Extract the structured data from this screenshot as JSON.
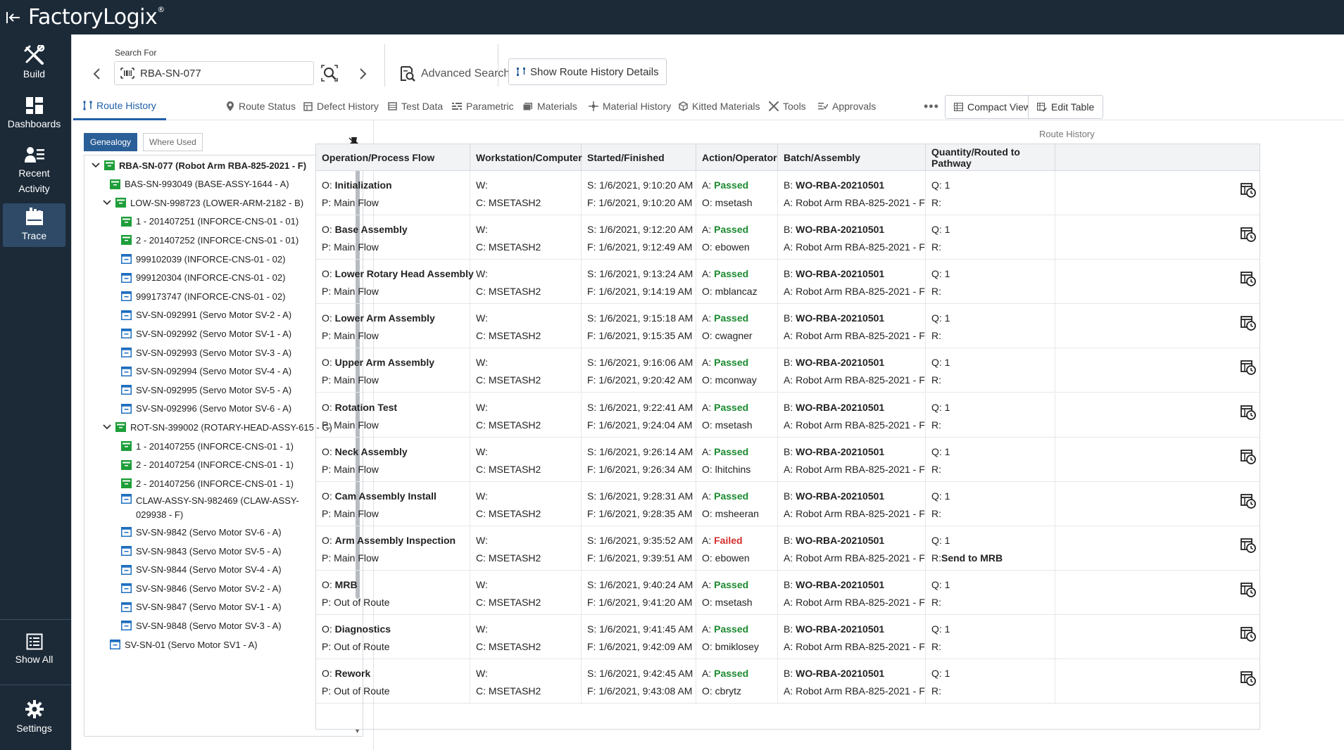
{
  "app": {
    "logo": "FactoryLogix",
    "logo_mark": "®"
  },
  "nav": {
    "items": [
      {
        "label": "Build",
        "icon": "tools-icon"
      },
      {
        "label": "Dashboards",
        "icon": "dashboard-icon"
      },
      {
        "label": "Recent Activity",
        "icon": "recent-activity-icon"
      },
      {
        "label": "Trace",
        "icon": "trace-icon",
        "active": true
      }
    ],
    "bottom": [
      {
        "label": "Show All",
        "icon": "list-icon"
      },
      {
        "label": "Settings",
        "icon": "gear-icon"
      }
    ]
  },
  "search": {
    "label": "Search For",
    "value": "RBA-SN-077",
    "advanced": "Advanced Search",
    "show_details": "Show Route History Details"
  },
  "tabs": [
    {
      "label": "Route History",
      "icon": "route-icon",
      "active": true
    },
    {
      "label": "Route Status",
      "icon": "pin-icon"
    },
    {
      "label": "Defect History",
      "icon": "defect-icon"
    },
    {
      "label": "Test Data",
      "icon": "test-data-icon"
    },
    {
      "label": "Parametric",
      "icon": "parametric-icon"
    },
    {
      "label": "Materials",
      "icon": "materials-icon"
    },
    {
      "label": "Material History",
      "icon": "material-history-icon"
    },
    {
      "label": "Kitted Materials",
      "icon": "kitted-icon"
    },
    {
      "label": "Tools",
      "icon": "tools-icon"
    },
    {
      "label": "Approvals",
      "icon": "approvals-icon"
    }
  ],
  "tab_more": "•••",
  "view_buttons": {
    "compact": "Compact View",
    "edit": "Edit Table"
  },
  "tree": {
    "genealogy": "Genealogy",
    "where_used": "Where Used",
    "nodes": [
      {
        "label": "RBA-SN-077 (Robot Arm RBA-825-2021 - F)",
        "level": 0,
        "expander": "open",
        "icon": "green",
        "bold": true
      },
      {
        "label": "BAS-SN-993049 (BASE-ASSY-1644 - A)",
        "level": 1,
        "expander": "none",
        "icon": "green"
      },
      {
        "label": "LOW-SN-998723 (LOWER-ARM-2182 - B)",
        "level": 1,
        "expander": "open",
        "icon": "green"
      },
      {
        "label": "1 - 201407251 (INFORCE-CNS-01 - 01)",
        "level": 2,
        "expander": "none",
        "icon": "green"
      },
      {
        "label": "2 - 201407252 (INFORCE-CNS-01 - 01)",
        "level": 2,
        "expander": "none",
        "icon": "green"
      },
      {
        "label": "999102039 (INFORCE-CNS-01 - 02)",
        "level": 2,
        "expander": "none",
        "icon": "blue"
      },
      {
        "label": "999120304 (INFORCE-CNS-01 - 02)",
        "level": 2,
        "expander": "none",
        "icon": "blue"
      },
      {
        "label": "999173747 (INFORCE-CNS-01 - 02)",
        "level": 2,
        "expander": "none",
        "icon": "blue"
      },
      {
        "label": "SV-SN-092991 (Servo Motor SV-2 - A)",
        "level": 2,
        "expander": "none",
        "icon": "blue"
      },
      {
        "label": "SV-SN-092992 (Servo Motor SV-1 - A)",
        "level": 2,
        "expander": "none",
        "icon": "blue"
      },
      {
        "label": "SV-SN-092993 (Servo Motor SV-3 - A)",
        "level": 2,
        "expander": "none",
        "icon": "blue"
      },
      {
        "label": "SV-SN-092994 (Servo Motor SV-4 - A)",
        "level": 2,
        "expander": "none",
        "icon": "blue"
      },
      {
        "label": "SV-SN-092995 (Servo Motor SV-5 - A)",
        "level": 2,
        "expander": "none",
        "icon": "blue"
      },
      {
        "label": "SV-SN-092996 (Servo Motor SV-6 - A)",
        "level": 2,
        "expander": "none",
        "icon": "blue"
      },
      {
        "label": "ROT-SN-399002 (ROTARY-HEAD-ASSY-615 - G)",
        "level": 1,
        "expander": "open",
        "icon": "green"
      },
      {
        "label": "1 - 201407255 (INFORCE-CNS-01 - 1)",
        "level": 2,
        "expander": "none",
        "icon": "green"
      },
      {
        "label": "2 - 201407254 (INFORCE-CNS-01 - 1)",
        "level": 2,
        "expander": "none",
        "icon": "green"
      },
      {
        "label": "2 - 201407256 (INFORCE-CNS-01 - 1)",
        "level": 2,
        "expander": "none",
        "icon": "green"
      },
      {
        "label": "CLAW-ASSY-SN-982469 (CLAW-ASSY-029938 - F)",
        "level": 2,
        "expander": "none",
        "icon": "blue",
        "wrap": true
      },
      {
        "label": "SV-SN-9842 (Servo Motor SV-6 - A)",
        "level": 2,
        "expander": "none",
        "icon": "blue"
      },
      {
        "label": "SV-SN-9843 (Servo Motor SV-5 - A)",
        "level": 2,
        "expander": "none",
        "icon": "blue"
      },
      {
        "label": "SV-SN-9844 (Servo Motor SV-4 - A)",
        "level": 2,
        "expander": "none",
        "icon": "blue"
      },
      {
        "label": "SV-SN-9846 (Servo Motor SV-2 - A)",
        "level": 2,
        "expander": "none",
        "icon": "blue"
      },
      {
        "label": "SV-SN-9847 (Servo Motor SV-1 - A)",
        "level": 2,
        "expander": "none",
        "icon": "blue"
      },
      {
        "label": "SV-SN-9848 (Servo Motor SV-3 - A)",
        "level": 2,
        "expander": "none",
        "icon": "blue"
      },
      {
        "label": "SV-SN-01 (Servo Motor SV1 - A)",
        "level": 1,
        "expander": "none",
        "icon": "blue"
      }
    ]
  },
  "table": {
    "title": "Route History",
    "headers": [
      "Operation/Process Flow",
      "Workstation/Computer",
      "Started/Finished",
      "Action/Operator",
      "Batch/Assembly",
      "Quantity/Routed to Pathway"
    ],
    "prefix": {
      "op": "O: ",
      "pf": "P: ",
      "ws": "W:",
      "comp": "C: ",
      "start": "S: ",
      "finish": "F: ",
      "action": "A: ",
      "operator": "O: ",
      "batch": "B: ",
      "assembly": "A: ",
      "qty": "Q: ",
      "routed": "R:"
    },
    "rows": [
      {
        "op": "Initialization",
        "flow": "Main Flow",
        "ws": "",
        "computer": "MSETASH2",
        "start": "1/6/2021, 9:10:20 AM",
        "finish": "1/6/2021, 9:10:20 AM",
        "action": "Passed",
        "operator": "msetash",
        "batch": "WO-RBA-20210501",
        "assembly": "Robot Arm RBA-825-2021 - F",
        "qty": "1",
        "routed": ""
      },
      {
        "op": "Base Assembly",
        "flow": "Main Flow",
        "ws": "",
        "computer": "MSETASH2",
        "start": "1/6/2021, 9:12:20 AM",
        "finish": "1/6/2021, 9:12:49 AM",
        "action": "Passed",
        "operator": "ebowen",
        "batch": "WO-RBA-20210501",
        "assembly": "Robot Arm RBA-825-2021 - F",
        "qty": "1",
        "routed": ""
      },
      {
        "op": "Lower Rotary Head Assembly",
        "flow": "Main Flow",
        "ws": "",
        "computer": "MSETASH2",
        "start": "1/6/2021, 9:13:24 AM",
        "finish": "1/6/2021, 9:14:19 AM",
        "action": "Passed",
        "operator": "mblancaz",
        "batch": "WO-RBA-20210501",
        "assembly": "Robot Arm RBA-825-2021 - F",
        "qty": "1",
        "routed": ""
      },
      {
        "op": "Lower Arm Assembly",
        "flow": "Main Flow",
        "ws": "",
        "computer": "MSETASH2",
        "start": "1/6/2021, 9:15:18 AM",
        "finish": "1/6/2021, 9:15:35 AM",
        "action": "Passed",
        "operator": "cwagner",
        "batch": "WO-RBA-20210501",
        "assembly": "Robot Arm RBA-825-2021 - F",
        "qty": "1",
        "routed": ""
      },
      {
        "op": "Upper Arm Assembly",
        "flow": "Main Flow",
        "ws": "",
        "computer": "MSETASH2",
        "start": "1/6/2021, 9:16:06 AM",
        "finish": "1/6/2021, 9:20:42 AM",
        "action": "Passed",
        "operator": "mconway",
        "batch": "WO-RBA-20210501",
        "assembly": "Robot Arm RBA-825-2021 - F",
        "qty": "1",
        "routed": ""
      },
      {
        "op": "Rotation Test",
        "flow": "Main Flow",
        "ws": "",
        "computer": "MSETASH2",
        "start": "1/6/2021, 9:22:41 AM",
        "finish": "1/6/2021, 9:24:04 AM",
        "action": "Passed",
        "operator": "msetash",
        "batch": "WO-RBA-20210501",
        "assembly": "Robot Arm RBA-825-2021 - F",
        "qty": "1",
        "routed": ""
      },
      {
        "op": "Neck Assembly",
        "flow": "Main Flow",
        "ws": "",
        "computer": "MSETASH2",
        "start": "1/6/2021, 9:26:14 AM",
        "finish": "1/6/2021, 9:26:34 AM",
        "action": "Passed",
        "operator": "lhitchins",
        "batch": "WO-RBA-20210501",
        "assembly": "Robot Arm RBA-825-2021 - F",
        "qty": "1",
        "routed": ""
      },
      {
        "op": "Cam Assembly Install",
        "flow": "Main Flow",
        "ws": "",
        "computer": "MSETASH2",
        "start": "1/6/2021, 9:28:31 AM",
        "finish": "1/6/2021, 9:28:35 AM",
        "action": "Passed",
        "operator": "msheeran",
        "batch": "WO-RBA-20210501",
        "assembly": "Robot Arm RBA-825-2021 - F",
        "qty": "1",
        "routed": ""
      },
      {
        "op": "Arm Assembly Inspection",
        "flow": "Main Flow",
        "ws": "",
        "computer": "MSETASH2",
        "start": "1/6/2021, 9:35:52 AM",
        "finish": "1/6/2021, 9:39:51 AM",
        "action": "Failed",
        "operator": "ebowen",
        "batch": "WO-RBA-20210501",
        "assembly": "Robot Arm RBA-825-2021 - F",
        "qty": "1",
        "routed": "Send to MRB"
      },
      {
        "op": "MRB",
        "flow": "Out of Route",
        "ws": "",
        "computer": "MSETASH2",
        "start": "1/6/2021, 9:40:24 AM",
        "finish": "1/6/2021, 9:41:20 AM",
        "action": "Passed",
        "operator": "msetash",
        "batch": "WO-RBA-20210501",
        "assembly": "Robot Arm RBA-825-2021 - F",
        "qty": "1",
        "routed": ""
      },
      {
        "op": "Diagnostics",
        "flow": "Out of Route",
        "ws": "",
        "computer": "MSETASH2",
        "start": "1/6/2021, 9:41:45 AM",
        "finish": "1/6/2021, 9:42:09 AM",
        "action": "Passed",
        "operator": "bmiklosey",
        "batch": "WO-RBA-20210501",
        "assembly": "Robot Arm RBA-825-2021 - F",
        "qty": "1",
        "routed": ""
      },
      {
        "op": "Rework",
        "flow": "Out of Route",
        "ws": "",
        "computer": "MSETASH2",
        "start": "1/6/2021, 9:42:45 AM",
        "finish": "1/6/2021, 9:43:08 AM",
        "action": "Passed",
        "operator": "cbrytz",
        "batch": "WO-RBA-20210501",
        "assembly": "Robot Arm RBA-825-2021 - F",
        "qty": "1",
        "routed": ""
      }
    ]
  },
  "colors": {
    "nav_bg": "#1c2a38",
    "accent": "#1f5fa8",
    "passed": "#1b8a2f",
    "failed": "#d32f2f",
    "tree_green": "#1e9e3a",
    "tree_blue": "#1f6fc0"
  }
}
